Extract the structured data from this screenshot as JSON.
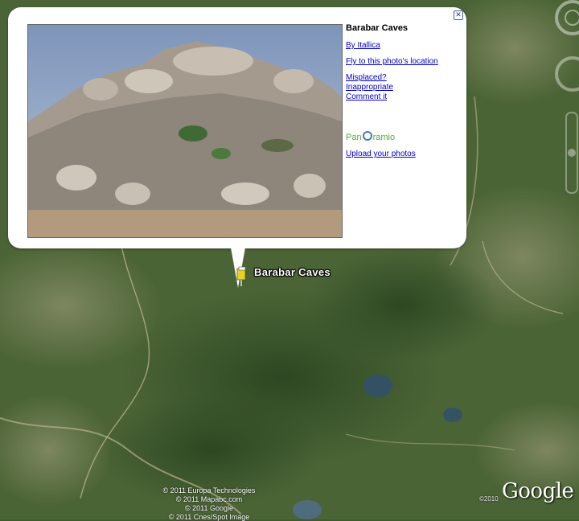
{
  "popup": {
    "title": "Barabar Caves",
    "close_glyph": "✕",
    "links": {
      "by_author": "By Itallica",
      "fly_to": "Fly to this photo's location",
      "misplaced": "Misplaced?",
      "inappropriate": "Inappropriate",
      "comment": "Comment it",
      "upload": "Upload your photos"
    },
    "logo": {
      "pre": "Pan",
      "post": "ramio"
    }
  },
  "map": {
    "placemark_label": "Barabar Caves",
    "copyright": [
      "© 2011 Europa Technologies",
      "© 2011 Mapabc.com",
      "© 2011 Google",
      "© 2011 Cnes/Spot Image"
    ],
    "year": "©2010",
    "logo": "Google"
  },
  "colors": {
    "link": "#0000cc",
    "panoramio_green": "#5aa83c",
    "panoramio_blue": "#3b7fc4",
    "terrain_dark": "#3f5a2c"
  }
}
